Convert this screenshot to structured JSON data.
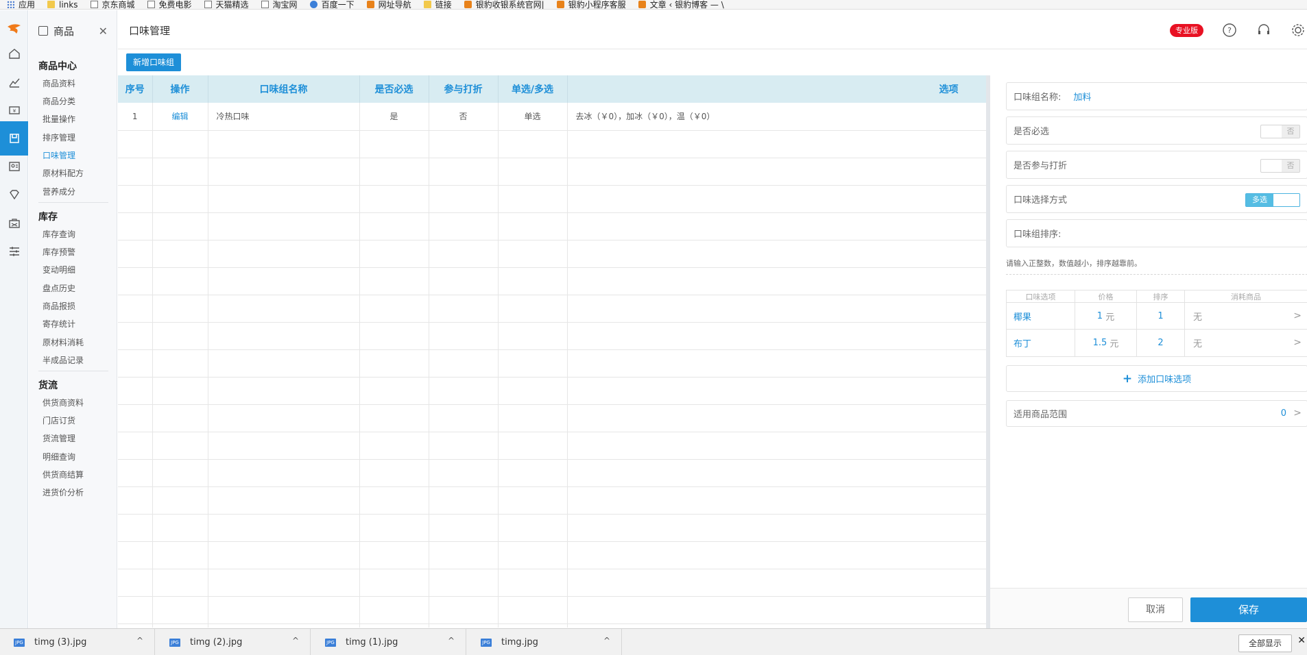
{
  "bookmarks": [
    {
      "label": "应用",
      "icon": "apps-icon"
    },
    {
      "label": "links",
      "icon": "folder-icon"
    },
    {
      "label": "京东商城",
      "icon": "page-icon"
    },
    {
      "label": "免费电影",
      "icon": "page-icon"
    },
    {
      "label": "天猫精选",
      "icon": "page-icon"
    },
    {
      "label": "淘宝网",
      "icon": "page-icon"
    },
    {
      "label": "百度一下",
      "icon": "baidu-icon"
    },
    {
      "label": "网址导航",
      "icon": "hao-icon"
    },
    {
      "label": "链接",
      "icon": "folder-icon"
    },
    {
      "label": "银豹收银系统官网|",
      "icon": "orange-icon"
    },
    {
      "label": "银豹小程序客服",
      "icon": "orange-icon"
    },
    {
      "label": "文章 ‹ 银豹博客 — \\",
      "icon": "orange-icon"
    }
  ],
  "sidebar": {
    "module_title": "商品",
    "sections": [
      {
        "title": "商品中心",
        "items": [
          "商品资料",
          "商品分类",
          "批量操作",
          "排序管理",
          "口味管理",
          "原材料配方",
          "营养成分"
        ]
      },
      {
        "title": "库存",
        "items": [
          "库存查询",
          "库存预警",
          "变动明细",
          "盘点历史",
          "商品报损",
          "寄存统计",
          "原材料消耗",
          "半成品记录"
        ]
      },
      {
        "title": "货流",
        "items": [
          "供货商资料",
          "门店订货",
          "货流管理",
          "明细查询",
          "供货商结算",
          "进货价分析"
        ]
      }
    ],
    "active_item": "口味管理"
  },
  "header": {
    "title": "口味管理",
    "edition_badge": "专业版"
  },
  "toolbar": {
    "new_group_label": "新增口味组"
  },
  "table": {
    "columns": [
      "序号",
      "操作",
      "口味组名称",
      "是否必选",
      "参与打折",
      "单选/多选",
      "选项"
    ],
    "rows": [
      {
        "index": "1",
        "action": "编辑",
        "name": "冷热口味",
        "required": "是",
        "discount": "否",
        "mode": "单选",
        "options": "去冰（￥0），加冰（￥0），温（￥0）"
      }
    ]
  },
  "drawer": {
    "group_name_label": "口味组名称:",
    "group_name_value": "加料",
    "required_label": "是否必选",
    "required_toggle": "否",
    "discount_label": "是否参与打折",
    "discount_toggle": "否",
    "select_mode_label": "口味选择方式",
    "select_mode_toggle": "多选",
    "sort_label": "口味组排序:",
    "sort_hint": "请输入正整数，数值越小，排序越靠前。",
    "options_columns": [
      "口味选项",
      "价格",
      "排序",
      "消耗商品"
    ],
    "options": [
      {
        "name": "椰果",
        "price": "1",
        "unit": "元",
        "sort": "1",
        "consume": "无"
      },
      {
        "name": "布丁",
        "price": "1.5",
        "unit": "元",
        "sort": "2",
        "consume": "无"
      }
    ],
    "add_option_label": "添加口味选项",
    "scope_label": "适用商品范围",
    "scope_count": "0",
    "cancel_label": "取消",
    "save_label": "保存"
  },
  "downloads": {
    "files": [
      "timg (3).jpg",
      "timg (2).jpg",
      "timg (1).jpg",
      "timg.jpg"
    ],
    "file_type": "JPG",
    "show_all_label": "全部显示"
  },
  "colors": {
    "accent": "#1e8fd8",
    "header_bg": "#d8ecf2",
    "badge": "#e81123"
  }
}
